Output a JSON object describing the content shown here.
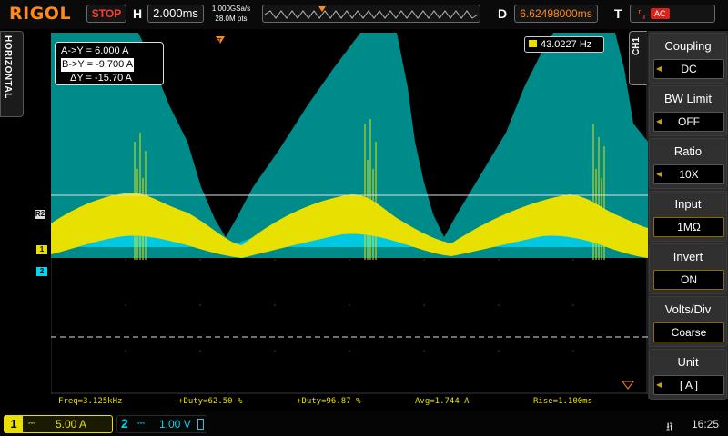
{
  "brand": "RIGOL",
  "status": {
    "run_state": "STOP"
  },
  "horizontal": {
    "label": "H",
    "timebase": "2.000ms",
    "sample_rate": "1.000GSa/s",
    "memory_depth": "28.0M pts",
    "delay_label": "D",
    "delay": "6.62498000ms"
  },
  "trigger": {
    "label": "T",
    "source": "AC",
    "icon": "trigger-rising-edge-icon"
  },
  "side_tab": "HORIZONTAL",
  "channel_tab": "CH1",
  "markers": {
    "ref": "R2",
    "ch1": "1",
    "ch2": "2"
  },
  "cursors": {
    "ay": "A->Y = 6.000 A",
    "by": "B->Y = -9.700 A",
    "dy": "ΔY = -15.70 A"
  },
  "frequency_readout": "43.0227 Hz",
  "menu": [
    {
      "title": "Coupling",
      "value": "DC"
    },
    {
      "title": "BW Limit",
      "value": "OFF"
    },
    {
      "title": "Ratio",
      "value": "10X"
    },
    {
      "title": "Input",
      "value": "1MΩ"
    },
    {
      "title": "Invert",
      "value": "ON"
    },
    {
      "title": "Volts/Div",
      "value": "Coarse"
    },
    {
      "title": "Unit",
      "value": "[ A ]"
    }
  ],
  "measurements": {
    "freq": "Freq=3.125kHz",
    "duty": "+Duty=62.50 %",
    "duty2": "+Duty=96.87 %",
    "avg": "Avg=1.744 A",
    "rise": "Rise=1.100ms"
  },
  "channels": {
    "ch1": {
      "number": "1",
      "scale": "5.00 A",
      "coupling_icon": "dc-coupling-icon"
    },
    "ch2": {
      "number": "2",
      "scale": "1.00 V",
      "coupling_icon": "dc-coupling-icon"
    }
  },
  "clock": "16:25",
  "colors": {
    "ch1": "#e8e000",
    "ch2": "#00d8f0",
    "teal_fill": "#008b8b",
    "accent": "#ff8a1a",
    "stop": "#ff3b30"
  }
}
